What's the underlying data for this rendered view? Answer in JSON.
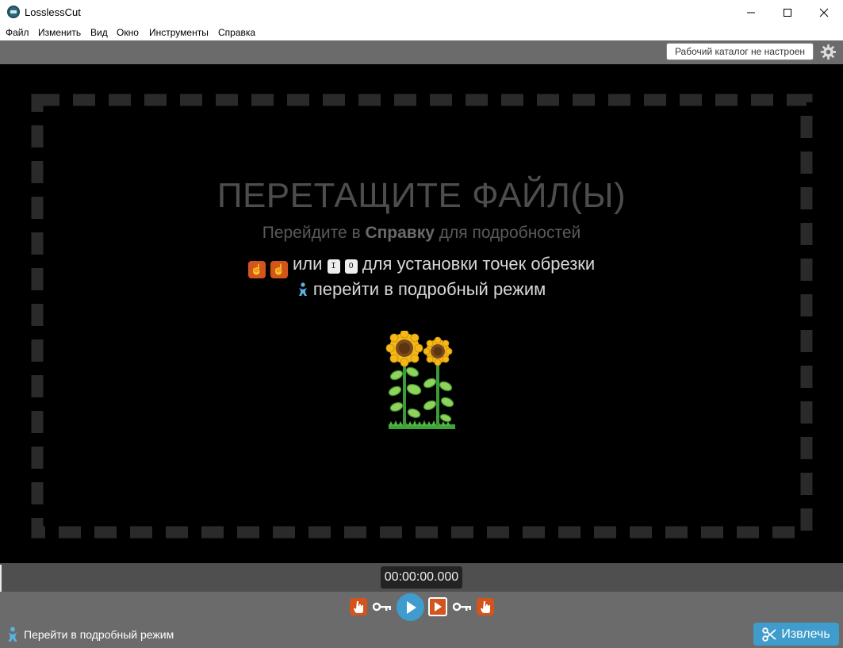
{
  "window": {
    "title": "LosslessCut",
    "minimize": "─",
    "maximize": "☐",
    "close": "✕"
  },
  "menu": [
    "Файл",
    "Изменить",
    "Вид",
    "Окно",
    "Инструменты",
    "Справка"
  ],
  "toolbar": {
    "working_dir": "Рабочий каталог не настроен",
    "settings_icon": "gear-icon"
  },
  "dropzone": {
    "title": "ПЕРЕТАЩИТЕ ФАЙЛ(Ы)",
    "help_prefix": "Перейдите в ",
    "help_bold": "Справку",
    "help_suffix": " для подробностей",
    "cut_or": " или ",
    "key_in": "I",
    "key_out": "O",
    "cut_suffix": " для установки точек обрезки",
    "simple_mode": " перейти в подробный режим"
  },
  "timeline": {
    "timecode": "00:00:00.000"
  },
  "bottom": {
    "simple_mode_label": "Перейти в подробный режим",
    "export_label": "Извлечь"
  },
  "colors": {
    "accent": "#3f9ccc",
    "cut_orange": "#d4541d",
    "toolbar_gray": "#6b6b6b"
  }
}
